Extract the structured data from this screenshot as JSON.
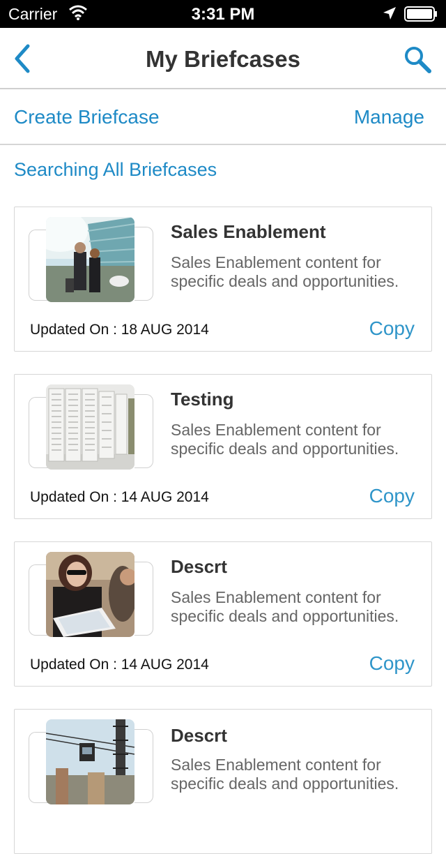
{
  "status_bar": {
    "carrier": "Carrier",
    "time": "3:31 PM",
    "icons": [
      "wifi-icon",
      "location-arrow-icon",
      "battery-icon"
    ]
  },
  "nav": {
    "title": "My Briefcases",
    "back_icon": "chevron-left-icon",
    "search_icon": "search-icon"
  },
  "actions": {
    "create_label": "Create Briefcase",
    "manage_label": "Manage"
  },
  "search_scope": "Searching All Briefcases",
  "accent_color": "#1e8ac6",
  "briefcases": [
    {
      "title": "Sales Enablement",
      "description": "Sales Enablement content for specific deals and opportunities.",
      "updated": "Updated On : 18 AUG 2014",
      "copy_label": "Copy",
      "thumbnail": "business-people-walking-photo"
    },
    {
      "title": "Testing",
      "description": "Sales Enablement content for specific deals and opportunities.",
      "updated": "Updated On : 14 AUG 2014",
      "copy_label": "Copy",
      "thumbnail": "server-racks-photo"
    },
    {
      "title": "Descrt",
      "description": "Sales Enablement content for specific deals and opportunities.",
      "updated": "Updated On : 14 AUG 2014",
      "copy_label": "Copy",
      "thumbnail": "woman-on-phone-with-tablet-photo"
    },
    {
      "title": "Descrt",
      "description": "Sales Enablement content for specific deals and opportunities.",
      "updated": "",
      "copy_label": "",
      "thumbnail": "city-tramway-photo"
    }
  ]
}
